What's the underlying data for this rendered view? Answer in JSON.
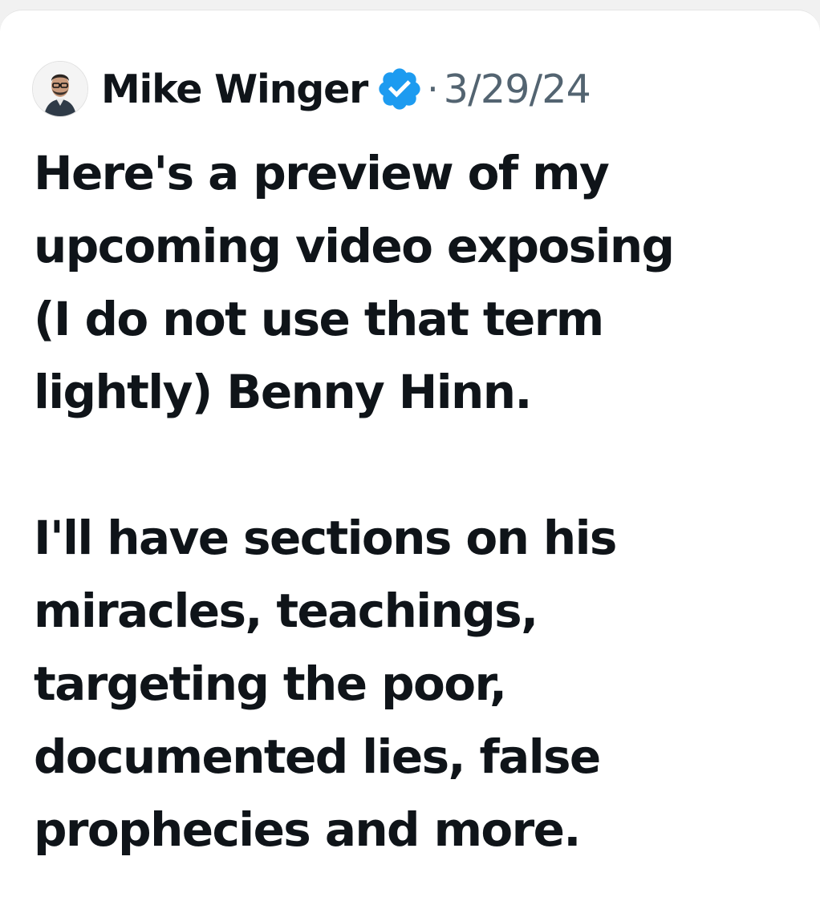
{
  "tweet": {
    "author": {
      "name": "Mike Winger",
      "verified": true,
      "avatar": "profile-photo"
    },
    "separator": "·",
    "date": "3/29/24",
    "paragraphs": [
      {
        "lines": [
          "Here's a preview of my",
          "upcoming video exposing",
          "(I do not use that term",
          "lightly) Benny Hinn."
        ]
      },
      {
        "lines": [
          "I'll have sections on his",
          "miracles, teachings,",
          "targeting the poor,",
          "documented lies, false",
          "prophecies and more."
        ]
      }
    ]
  },
  "colors": {
    "text": "#0f1419",
    "secondary": "#536471",
    "verified_badge": "#1d9bf0",
    "background": "#ffffff"
  }
}
